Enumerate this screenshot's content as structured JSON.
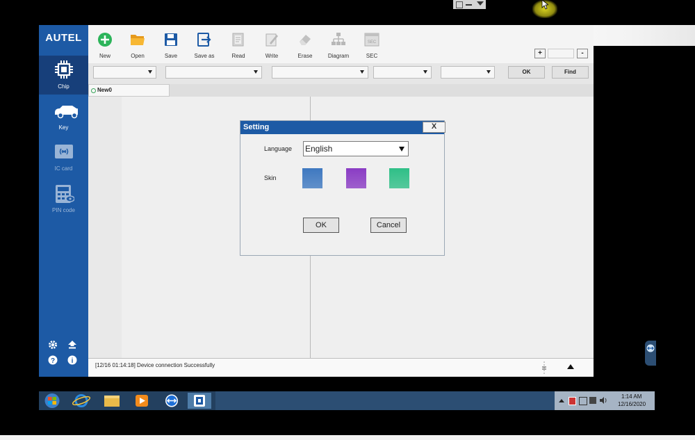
{
  "app": {
    "logo": "AUTEL",
    "sidebar": [
      {
        "label": "Chip",
        "icon": "chip-icon",
        "active": true
      },
      {
        "label": "Key",
        "icon": "key-icon",
        "active": false
      },
      {
        "label": "IC card",
        "icon": "ic-card-icon",
        "active": false
      },
      {
        "label": "PIN code",
        "icon": "pin-code-icon",
        "active": false
      }
    ],
    "toolbar": [
      {
        "label": "New",
        "icon": "plus-circle-icon"
      },
      {
        "label": "Open",
        "icon": "folder-icon"
      },
      {
        "label": "Save",
        "icon": "floppy-disk-icon"
      },
      {
        "label": "Save as",
        "icon": "save-as-icon"
      },
      {
        "label": "Read",
        "icon": "read-icon"
      },
      {
        "label": "Write",
        "icon": "write-icon"
      },
      {
        "label": "Erase",
        "icon": "eraser-icon"
      },
      {
        "label": "Diagram",
        "icon": "diagram-icon"
      },
      {
        "label": "SEC",
        "icon": "sec-icon"
      }
    ],
    "filter_ok": "OK",
    "filter_find": "Find",
    "zoom_plus": "+",
    "zoom_minus": "-",
    "tab": "New0",
    "status": "[12/16 01:14:18] Device connection Successfully"
  },
  "dialog": {
    "title": "Setting",
    "close": "X",
    "language_label": "Language",
    "language_value": "English",
    "skin_label": "Skin",
    "skins": [
      "#3e78c0",
      "#8a3cc4",
      "#2fbf87"
    ],
    "ok": "OK",
    "cancel": "Cancel"
  },
  "taskbar": {
    "time": "1:14 AM",
    "date": "12/16/2020"
  }
}
